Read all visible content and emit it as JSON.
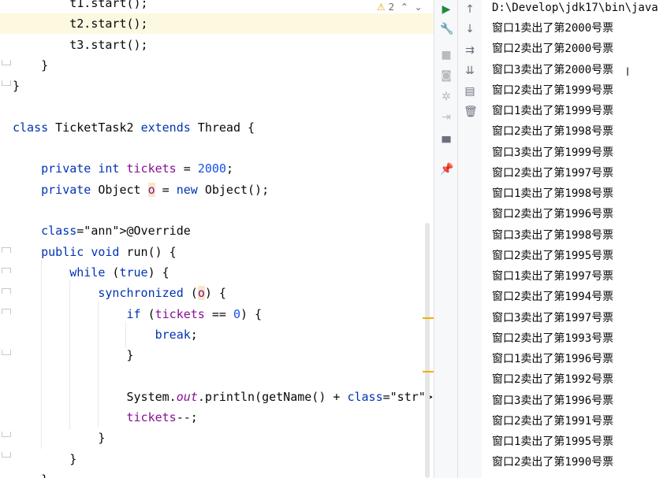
{
  "editor": {
    "inspection_count": "2",
    "lines": [
      [
        "        t1.start();"
      ],
      [
        "        t2.start();"
      ],
      [
        "        t3.start();"
      ],
      [
        "    }"
      ],
      [
        "}"
      ],
      [
        ""
      ],
      [
        "class TicketTask2 extends Thread {"
      ],
      [
        ""
      ],
      [
        "    private int tickets = 2000;"
      ],
      [
        "    private Object o = new Object();"
      ],
      [
        ""
      ],
      [
        "    @Override"
      ],
      [
        "    public void run() {"
      ],
      [
        "        while (true) {"
      ],
      [
        "            synchronized (o) {"
      ],
      [
        "                if (tickets == 0) {"
      ],
      [
        "                    break;"
      ],
      [
        "                }"
      ],
      [
        ""
      ],
      [
        "                System.out.println(getName() + \"卖出了第\" + ti"
      ],
      [
        "                tickets--;"
      ],
      [
        "            }"
      ],
      [
        "        }"
      ],
      [
        "    }"
      ]
    ]
  },
  "console": {
    "header": "D:\\Develop\\jdk17\\bin\\java",
    "lines": [
      "窗口1卖出了第2000号票",
      "窗口2卖出了第2000号票",
      "窗口3卖出了第2000号票",
      "窗口2卖出了第1999号票",
      "窗口1卖出了第1999号票",
      "窗口2卖出了第1998号票",
      "窗口3卖出了第1999号票",
      "窗口2卖出了第1997号票",
      "窗口1卖出了第1998号票",
      "窗口2卖出了第1996号票",
      "窗口3卖出了第1998号票",
      "窗口2卖出了第1995号票",
      "窗口1卖出了第1997号票",
      "窗口2卖出了第1994号票",
      "窗口3卖出了第1997号票",
      "窗口2卖出了第1993号票",
      "窗口1卖出了第1996号票",
      "窗口2卖出了第1992号票",
      "窗口3卖出了第1996号票",
      "窗口2卖出了第1991号票",
      "窗口1卖出了第1995号票",
      "窗口2卖出了第1990号票"
    ]
  },
  "run_toolbar": [
    "run-icon",
    "wrench-icon",
    "stop-icon",
    "camera-icon",
    "bug-icon",
    "exit-icon",
    "layout-icon",
    "pin-icon"
  ],
  "console_toolbar": [
    "up-arrow-icon",
    "down-arrow-icon",
    "soft-wrap-icon",
    "scroll-end-icon",
    "print-icon",
    "trash-icon"
  ]
}
